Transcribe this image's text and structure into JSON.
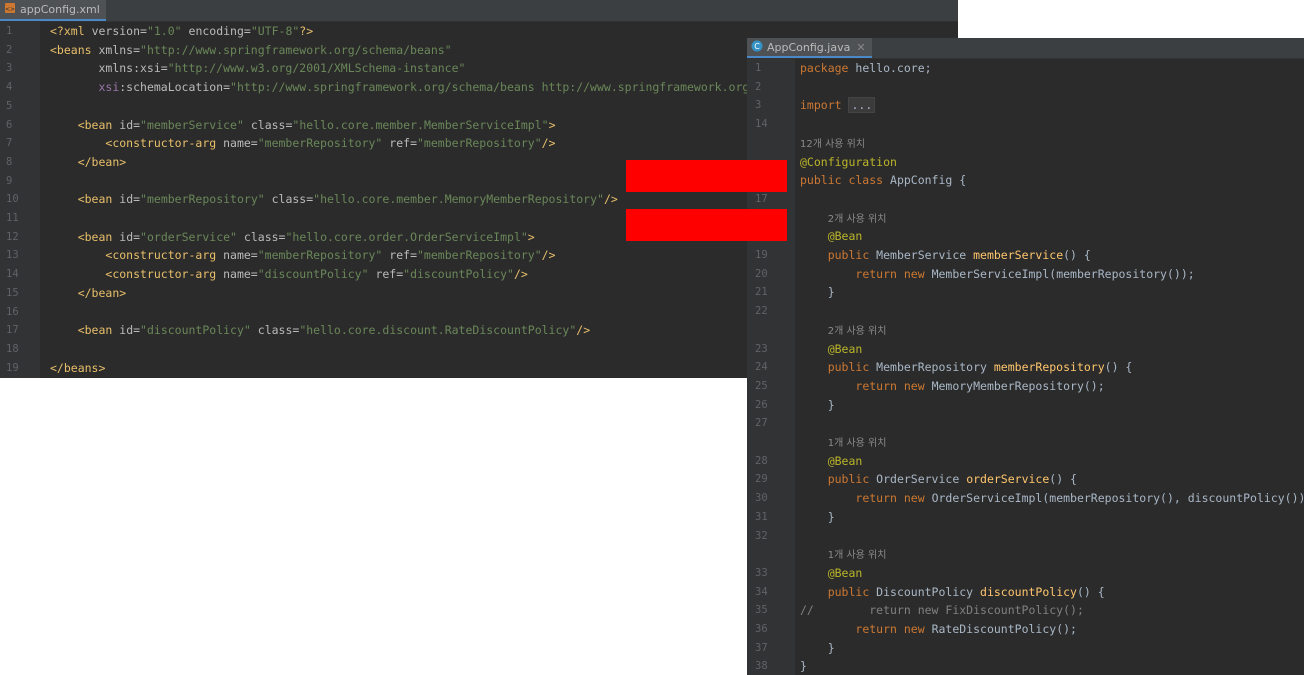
{
  "xml_editor": {
    "tab": {
      "label": "appConfig.xml",
      "icon": "xml-file-icon"
    },
    "lines": [
      {
        "n": "1",
        "html": "<span class=\"t-tag\">&lt;?xml</span> <span class=\"t-attr\">version=</span><span class=\"t-str\">\"1.0\"</span> <span class=\"t-attr\">encoding=</span><span class=\"t-str\">\"UTF-8\"</span><span class=\"t-tag\">?&gt;</span>"
      },
      {
        "n": "2",
        "html": "<span class=\"t-tag\">&lt;beans</span> <span class=\"t-attr\">xmlns=</span><span class=\"t-str\">\"http://www.springframework.org/schema/beans\"</span>"
      },
      {
        "n": "3",
        "html": "       <span class=\"t-attr\">xmlns:xsi=</span><span class=\"t-str\">\"http://www.w3.org/2001/XMLSchema-instance\"</span>"
      },
      {
        "n": "4",
        "html": "       <span class=\"t-ns\">xsi</span><span class=\"t-attr\">:schemaLocation=</span><span class=\"t-str\">\"http://www.springframework.org/schema/beans http://www.springframework.org/s</span>"
      },
      {
        "n": "5",
        "html": ""
      },
      {
        "n": "6",
        "html": "    <span class=\"t-tag\">&lt;bean</span> <span class=\"t-attr\">id=</span><span class=\"t-str\">\"memberService\"</span> <span class=\"t-attr\">class=</span><span class=\"t-str\">\"hello.core.member.MemberServiceImpl\"</span><span class=\"t-tag\">&gt;</span>"
      },
      {
        "n": "7",
        "html": "        <span class=\"t-tag\">&lt;constructor-arg</span> <span class=\"t-attr\">name=</span><span class=\"t-str\">\"memberRepository\"</span> <span class=\"t-attr\">ref=</span><span class=\"t-str\">\"memberRepository\"</span><span class=\"t-tag\">/&gt;</span>"
      },
      {
        "n": "8",
        "html": "    <span class=\"t-tag\">&lt;/bean&gt;</span>"
      },
      {
        "n": "9",
        "html": ""
      },
      {
        "n": "10",
        "html": "    <span class=\"t-tag\">&lt;bean</span> <span class=\"t-attr\">id=</span><span class=\"t-str\">\"memberRepository\"</span> <span class=\"t-attr\">class=</span><span class=\"t-str\">\"hello.core.member.MemoryMemberRepository\"</span><span class=\"t-tag\">/&gt;</span>"
      },
      {
        "n": "11",
        "html": ""
      },
      {
        "n": "12",
        "html": "    <span class=\"t-tag\">&lt;bean</span> <span class=\"t-attr\">id=</span><span class=\"t-str\">\"orderService\"</span> <span class=\"t-attr\">class=</span><span class=\"t-str\">\"hello.core.order.OrderServiceImpl\"</span><span class=\"t-tag\">&gt;</span>"
      },
      {
        "n": "13",
        "html": "        <span class=\"t-tag\">&lt;constructor-arg</span> <span class=\"t-attr\">name=</span><span class=\"t-str\">\"memberRepository\"</span> <span class=\"t-attr\">ref=</span><span class=\"t-str\">\"memberRepository\"</span><span class=\"t-tag\">/&gt;</span>"
      },
      {
        "n": "14",
        "html": "        <span class=\"t-tag\">&lt;constructor-arg</span> <span class=\"t-attr\">name=</span><span class=\"t-str\">\"discountPolicy\"</span> <span class=\"t-attr\">ref=</span><span class=\"t-str\">\"discountPolicy\"</span><span class=\"t-tag\">/&gt;</span>"
      },
      {
        "n": "15",
        "html": "    <span class=\"t-tag\">&lt;/bean&gt;</span>"
      },
      {
        "n": "16",
        "html": ""
      },
      {
        "n": "17",
        "html": "    <span class=\"t-tag\">&lt;bean</span> <span class=\"t-attr\">id=</span><span class=\"t-str\">\"discountPolicy\"</span> <span class=\"t-attr\">class=</span><span class=\"t-str\">\"hello.core.discount.RateDiscountPolicy\"</span><span class=\"t-tag\">/&gt;</span>"
      },
      {
        "n": "18",
        "html": ""
      },
      {
        "n": "19",
        "html": "<span class=\"t-tag\">&lt;/beans&gt;</span>"
      }
    ]
  },
  "java_editor": {
    "tab": {
      "label": "AppConfig.java",
      "icon": "java-class-icon"
    },
    "lines": [
      {
        "n": "1",
        "html": "<span class=\"t-kw\">package</span> hello.core;"
      },
      {
        "n": "2",
        "html": ""
      },
      {
        "n": "3",
        "html": "<span class=\"t-kw\">import</span> <span class=\"t-fold-box\">...</span>"
      },
      {
        "n": "14",
        "html": ""
      },
      {
        "n": "",
        "html": "<span class=\"hint\">12개 사용 위치</span>"
      },
      {
        "n": "",
        "html": "<span class=\"t-ann\">@Configuration</span>"
      },
      {
        "n": "",
        "html": "<span class=\"t-kw\">public class</span> AppConfig {"
      },
      {
        "n": "17",
        "html": ""
      },
      {
        "n": "",
        "html": "    <span class=\"hint\">2개 사용 위치</span>"
      },
      {
        "n": "",
        "html": "    <span class=\"t-ann\">@Bean</span>"
      },
      {
        "n": "19",
        "html": "    <span class=\"t-kw\">public</span> MemberService <span class=\"t-fn\">memberService</span>() {"
      },
      {
        "n": "20",
        "html": "        <span class=\"t-kw\">return new</span> MemberServiceImpl(memberRepository());"
      },
      {
        "n": "21",
        "html": "    }"
      },
      {
        "n": "22",
        "html": ""
      },
      {
        "n": "",
        "html": "    <span class=\"hint\">2개 사용 위치</span>"
      },
      {
        "n": "23",
        "html": "    <span class=\"t-ann\">@Bean</span>"
      },
      {
        "n": "24",
        "html": "    <span class=\"t-kw\">public</span> MemberRepository <span class=\"t-fn\">memberRepository</span>() {"
      },
      {
        "n": "25",
        "html": "        <span class=\"t-kw\">return new</span> MemoryMemberRepository();"
      },
      {
        "n": "26",
        "html": "    }"
      },
      {
        "n": "27",
        "html": ""
      },
      {
        "n": "",
        "html": "    <span class=\"hint\">1개 사용 위치</span>"
      },
      {
        "n": "28",
        "html": "    <span class=\"t-ann\">@Bean</span>"
      },
      {
        "n": "29",
        "html": "    <span class=\"t-kw\">public</span> OrderService <span class=\"t-fn\">orderService</span>() {"
      },
      {
        "n": "30",
        "html": "        <span class=\"t-kw\">return new</span> OrderServiceImpl(memberRepository(), discountPolicy());"
      },
      {
        "n": "31",
        "html": "    }"
      },
      {
        "n": "32",
        "html": ""
      },
      {
        "n": "",
        "html": "    <span class=\"hint\">1개 사용 위치</span>"
      },
      {
        "n": "33",
        "html": "    <span class=\"t-ann\">@Bean</span>"
      },
      {
        "n": "34",
        "html": "    <span class=\"t-kw\">public</span> DiscountPolicy <span class=\"t-fn\">discountPolicy</span>() {"
      },
      {
        "n": "35",
        "html": "<span class=\"t-cm\">//        return new FixDiscountPolicy();</span>"
      },
      {
        "n": "36",
        "html": "        <span class=\"t-kw\">return new</span> RateDiscountPolicy();"
      },
      {
        "n": "37",
        "html": "    }"
      },
      {
        "n": "38",
        "html": "}"
      }
    ]
  },
  "overlay": {
    "color": "#ff0000"
  }
}
